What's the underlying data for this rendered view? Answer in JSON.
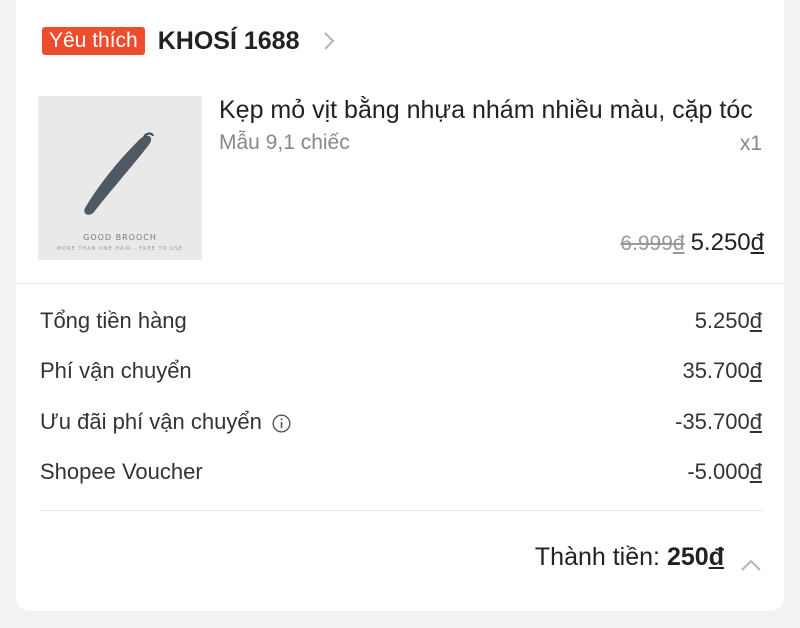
{
  "shop": {
    "badge": "Yêu thích",
    "name": "KHOSÍ 1688"
  },
  "product": {
    "image_caption": "GOOD BROOCH",
    "image_caption_small": "MORE THAN ONE HAIR · FREE TO USE",
    "title": "Kẹp mỏ vịt bằng nhựa nhám nhiều màu, cặp tóc",
    "variant": "Mẫu 9,1 chiếc",
    "quantity": "x1",
    "old_price_num": "6.999",
    "new_price_num": "5.250",
    "currency": "đ"
  },
  "summary": {
    "rows": [
      {
        "label": "Tổng tiền hàng",
        "value": "5.250"
      },
      {
        "label": "Phí vận chuyển",
        "value": "35.700"
      },
      {
        "label": "Ưu đãi phí vận chuyển",
        "value": "-35.700"
      },
      {
        "label": "Shopee Voucher",
        "value": "-5.000"
      }
    ]
  },
  "total": {
    "label": "Thành tiền:",
    "amount_num": "250"
  },
  "colors": {
    "accent": "#ee4d2d",
    "background": "#f2f2f2",
    "card": "#ffffff"
  },
  "icons": {
    "shop_chevron": "chevron-right-icon",
    "info": "info-icon",
    "collapse": "chevron-up-icon"
  }
}
